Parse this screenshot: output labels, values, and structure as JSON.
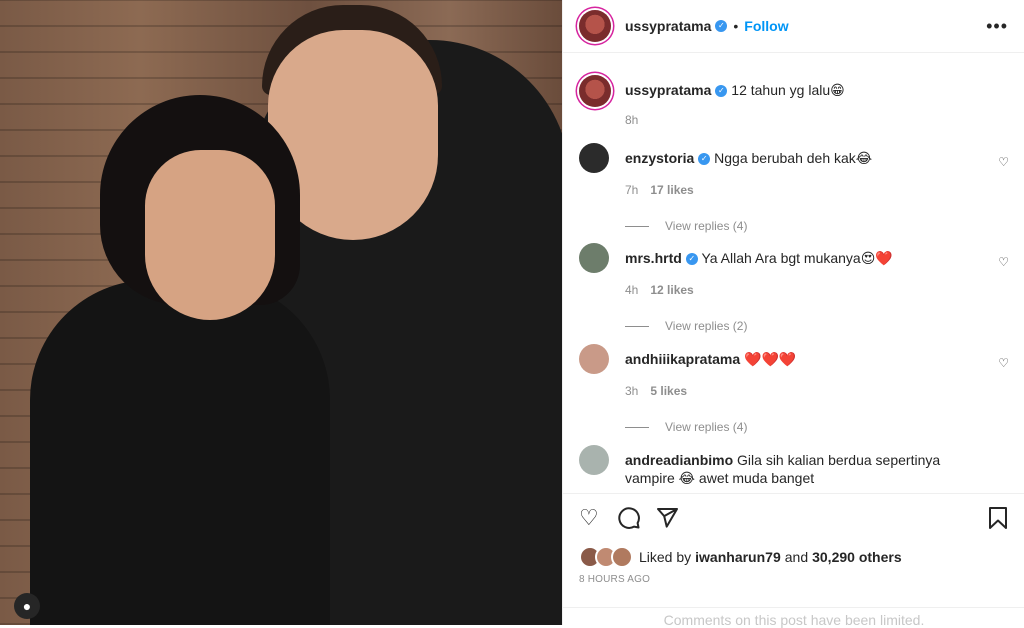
{
  "post": {
    "username": "ussypratama",
    "follow_label": "Follow",
    "more_label": "•••",
    "caption": "12 tahun yg lalu😁",
    "caption_time": "8h"
  },
  "comments": [
    {
      "user": "enzystoria",
      "verified": true,
      "text": "Ngga berubah deh kak😂",
      "time": "7h",
      "likes": "17 likes",
      "replies": "View replies (4)"
    },
    {
      "user": "mrs.hrtd",
      "verified": true,
      "text": "Ya Allah Ara bgt mukanya😍❤️",
      "time": "4h",
      "likes": "12 likes",
      "replies": "View replies (2)"
    },
    {
      "user": "andhiiikapratama",
      "verified": false,
      "text": "❤️❤️❤️",
      "time": "3h",
      "likes": "5 likes",
      "replies": "View replies (4)"
    },
    {
      "user": "andreadianbimo",
      "verified": false,
      "text": "Gila sih kalian berdua sepertinya vampire 😂 awet muda banget"
    }
  ],
  "likes": {
    "prefix": "Liked by",
    "user": "iwanharun79",
    "and": "and",
    "others": "30,290 others"
  },
  "post_age": "8 HOURS AGO",
  "comments_limited": "Comments on this post have been limited.",
  "icons": [
    "heart-icon",
    "comment-icon",
    "share-icon",
    "bookmark-icon",
    "more-icon",
    "verified-icon",
    "user-tag-icon"
  ],
  "colors": {
    "link": "#0095f6",
    "verified": "#3897f0",
    "muted": "#8e8e8e",
    "heart_red": "#ed4956"
  }
}
